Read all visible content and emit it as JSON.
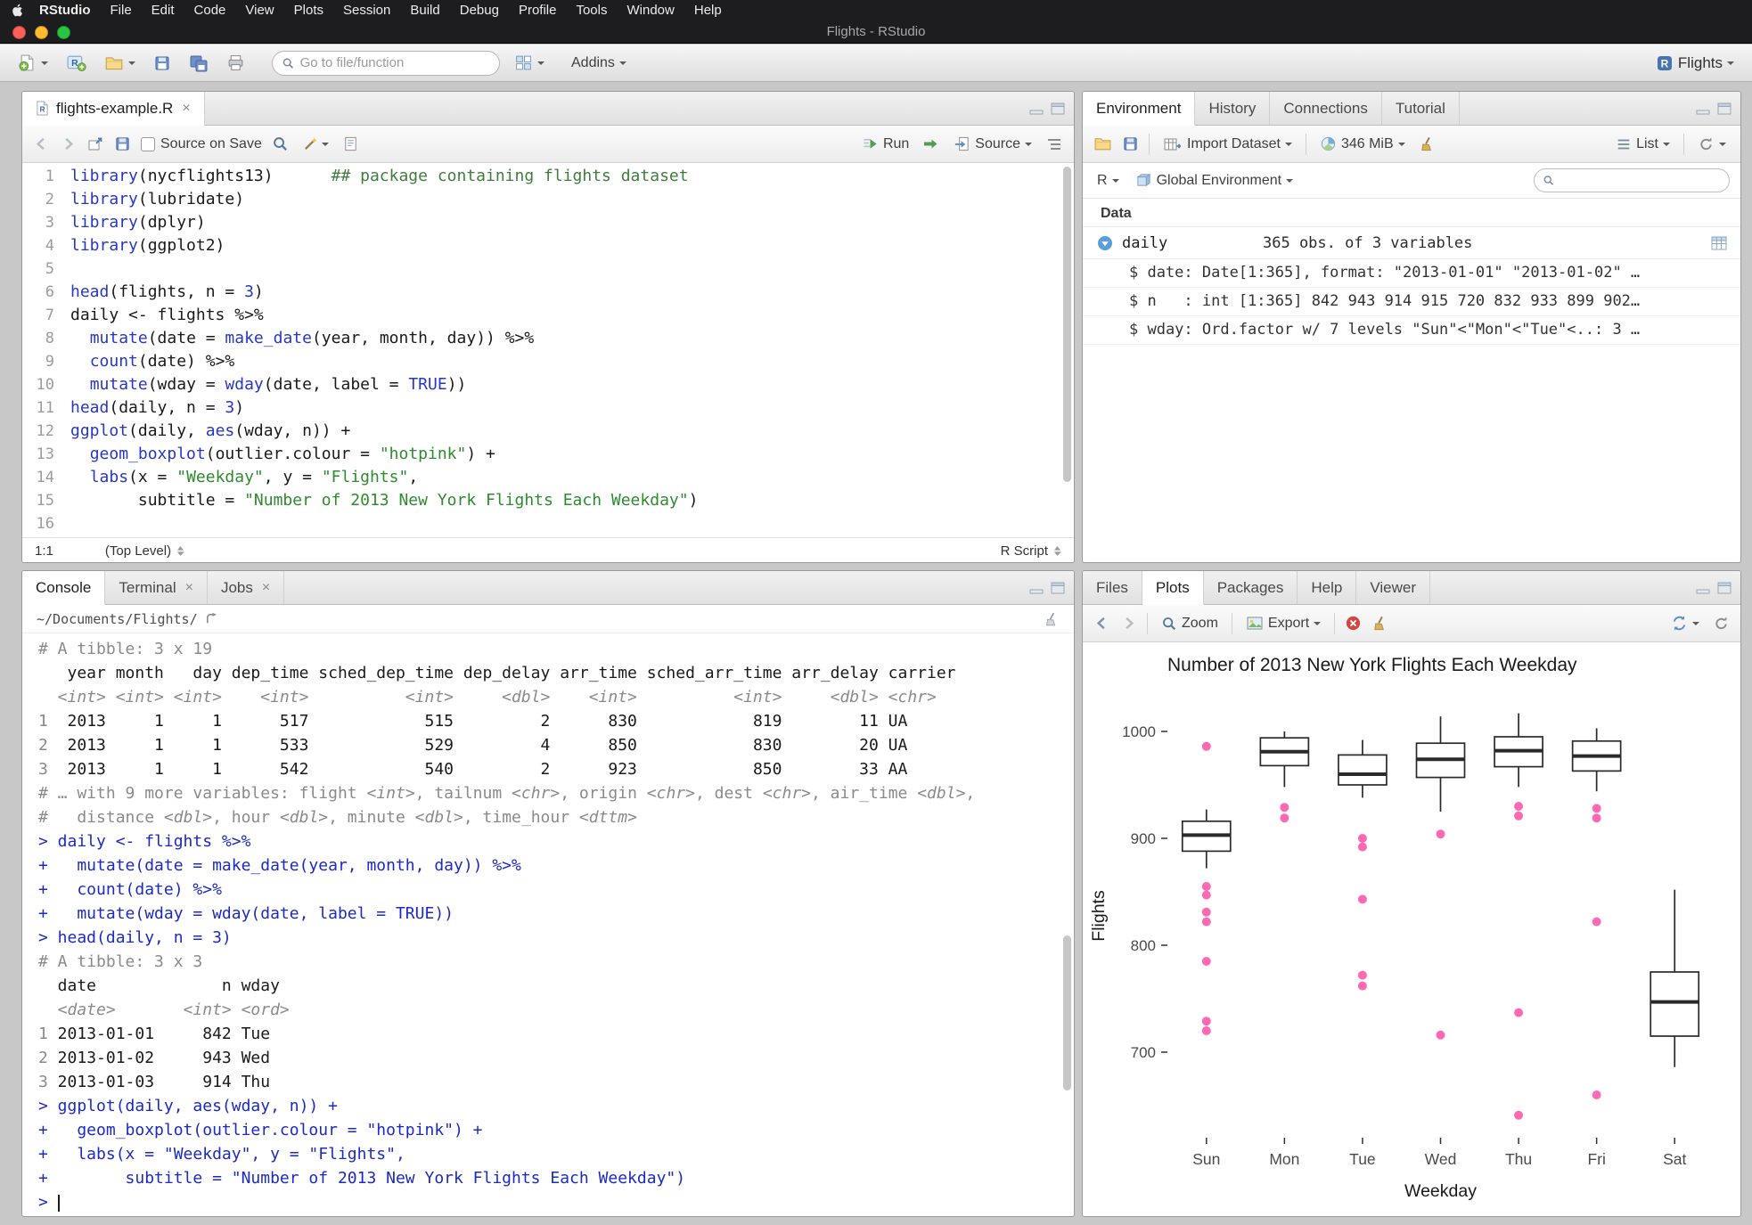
{
  "colors": {
    "hotpink": "#ff69b4",
    "accent": "#4775b4"
  },
  "icons": {
    "close": "×"
  },
  "menubar": {
    "app": "RStudio",
    "items": [
      "File",
      "Edit",
      "Code",
      "View",
      "Plots",
      "Session",
      "Build",
      "Debug",
      "Profile",
      "Tools",
      "Window",
      "Help"
    ],
    "window_title": "Flights - RStudio"
  },
  "main_toolbar": {
    "goto_placeholder": "Go to file/function",
    "addins_label": "Addins",
    "project_label": "Flights"
  },
  "source_pane": {
    "tab_title": "flights-example.R",
    "toolbar": {
      "source_on_save": "Source on Save",
      "run_label": "Run",
      "source_label": "Source"
    },
    "status": {
      "position": "1:1",
      "scope": "(Top Level)",
      "type": "R Script"
    },
    "code_lines": [
      [
        [
          "f",
          "library"
        ],
        [
          "t",
          "(nycflights13)"
        ],
        [
          "t",
          "      "
        ],
        [
          "c",
          "## package containing flights dataset"
        ]
      ],
      [
        [
          "f",
          "library"
        ],
        [
          "t",
          "(lubridate)"
        ]
      ],
      [
        [
          "f",
          "library"
        ],
        [
          "t",
          "(dplyr)"
        ]
      ],
      [
        [
          "f",
          "library"
        ],
        [
          "t",
          "(ggplot2)"
        ]
      ],
      [],
      [
        [
          "f",
          "head"
        ],
        [
          "t",
          "(flights, n = "
        ],
        [
          "n",
          "3"
        ],
        [
          "t",
          ")"
        ]
      ],
      [
        [
          "t",
          "daily <- flights %>%"
        ]
      ],
      [
        [
          "t",
          "  "
        ],
        [
          "f",
          "mutate"
        ],
        [
          "t",
          "(date = "
        ],
        [
          "f",
          "make_date"
        ],
        [
          "t",
          "(year, month, day)) %>%"
        ]
      ],
      [
        [
          "t",
          "  "
        ],
        [
          "f",
          "count"
        ],
        [
          "t",
          "(date) %>%"
        ]
      ],
      [
        [
          "t",
          "  "
        ],
        [
          "f",
          "mutate"
        ],
        [
          "t",
          "(wday = "
        ],
        [
          "f",
          "wday"
        ],
        [
          "t",
          "(date, label = "
        ],
        [
          "n",
          "TRUE"
        ],
        [
          "t",
          "))"
        ]
      ],
      [
        [
          "f",
          "head"
        ],
        [
          "t",
          "(daily, n = "
        ],
        [
          "n",
          "3"
        ],
        [
          "t",
          ")"
        ]
      ],
      [
        [
          "f",
          "ggplot"
        ],
        [
          "t",
          "(daily, "
        ],
        [
          "f",
          "aes"
        ],
        [
          "t",
          "(wday, n)) +"
        ]
      ],
      [
        [
          "t",
          "  "
        ],
        [
          "f",
          "geom_boxplot"
        ],
        [
          "t",
          "(outlier.colour = "
        ],
        [
          "s",
          "\"hotpink\""
        ],
        [
          "t",
          ") +"
        ]
      ],
      [
        [
          "t",
          "  "
        ],
        [
          "f",
          "labs"
        ],
        [
          "t",
          "(x = "
        ],
        [
          "s",
          "\"Weekday\""
        ],
        [
          "t",
          ", y = "
        ],
        [
          "s",
          "\"Flights\""
        ],
        [
          "t",
          ","
        ]
      ],
      [
        [
          "t",
          "       subtitle = "
        ],
        [
          "s",
          "\"Number of 2013 New York Flights Each Weekday\""
        ],
        [
          "t",
          ")"
        ]
      ],
      []
    ]
  },
  "console_pane": {
    "tabs": [
      {
        "label": "Console",
        "selected": true
      },
      {
        "label": "Terminal",
        "closable": true
      },
      {
        "label": "Jobs",
        "closable": true
      }
    ],
    "cwd": "~/Documents/Flights/",
    "lines": [
      [
        [
          "gr",
          "# A tibble: 3 x 19"
        ]
      ],
      [
        [
          "t",
          "   year month   day dep_time sched_dep_time dep_delay arr_time sched_arr_time arr_delay carrier"
        ]
      ],
      [
        [
          "it",
          "  <int> <int> <int>    <int>          <int>     <dbl>    <int>          <int>     <dbl> <chr>  "
        ]
      ],
      [
        [
          "gr",
          "1"
        ],
        [
          "t",
          "  2013     1     1      517            515         2      830            819        11 UA     "
        ]
      ],
      [
        [
          "gr",
          "2"
        ],
        [
          "t",
          "  2013     1     1      533            529         4      850            830        20 UA     "
        ]
      ],
      [
        [
          "gr",
          "3"
        ],
        [
          "t",
          "  2013     1     1      542            540         2      923            850        33 AA     "
        ]
      ],
      [
        [
          "gr",
          "# … with 9 more variables: flight "
        ],
        [
          "it",
          "<int>"
        ],
        [
          "gr",
          ", tailnum "
        ],
        [
          "it",
          "<chr>"
        ],
        [
          "gr",
          ", origin "
        ],
        [
          "it",
          "<chr>"
        ],
        [
          "gr",
          ", dest "
        ],
        [
          "it",
          "<chr>"
        ],
        [
          "gr",
          ", air_time "
        ],
        [
          "it",
          "<dbl>"
        ],
        [
          "gr",
          ","
        ]
      ],
      [
        [
          "gr",
          "#   distance "
        ],
        [
          "it",
          "<dbl>"
        ],
        [
          "gr",
          ", hour "
        ],
        [
          "it",
          "<dbl>"
        ],
        [
          "gr",
          ", minute "
        ],
        [
          "it",
          "<dbl>"
        ],
        [
          "gr",
          ", time_hour "
        ],
        [
          "it",
          "<dttm>"
        ]
      ],
      [
        [
          "in",
          "> daily <- flights %>%"
        ]
      ],
      [
        [
          "in",
          "+   mutate(date = make_date(year, month, day)) %>%"
        ]
      ],
      [
        [
          "in",
          "+   count(date) %>%"
        ]
      ],
      [
        [
          "in",
          "+   mutate(wday = wday(date, label = TRUE))"
        ]
      ],
      [
        [
          "in",
          "> head(daily, n = 3)"
        ]
      ],
      [
        [
          "gr",
          "# A tibble: 3 x 3"
        ]
      ],
      [
        [
          "t",
          "  date             n wday "
        ]
      ],
      [
        [
          "it",
          "  <date>       <int> <ord>"
        ]
      ],
      [
        [
          "gr",
          "1"
        ],
        [
          "t",
          " 2013-01-01     842 Tue  "
        ]
      ],
      [
        [
          "gr",
          "2"
        ],
        [
          "t",
          " 2013-01-02     943 Wed  "
        ]
      ],
      [
        [
          "gr",
          "3"
        ],
        [
          "t",
          " 2013-01-03     914 Thu  "
        ]
      ],
      [
        [
          "in",
          "> ggplot(daily, aes(wday, n)) +"
        ]
      ],
      [
        [
          "in",
          "+   geom_boxplot(outlier.colour = \"hotpink\") +"
        ]
      ],
      [
        [
          "in",
          "+   labs(x = \"Weekday\", y = \"Flights\","
        ]
      ],
      [
        [
          "in",
          "+        subtitle = \"Number of 2013 New York Flights Each Weekday\")"
        ]
      ],
      [
        [
          "in",
          "> "
        ]
      ]
    ]
  },
  "environment_pane": {
    "tabs": [
      {
        "label": "Environment",
        "selected": true
      },
      {
        "label": "History"
      },
      {
        "label": "Connections"
      },
      {
        "label": "Tutorial"
      }
    ],
    "toolbar": {
      "import_label": "Import Dataset",
      "memory_label": "346 MiB",
      "list_label": "List"
    },
    "toolbar2": {
      "lang": "R",
      "env_label": "Global Environment"
    },
    "section_label": "Data",
    "object": {
      "name": "daily",
      "desc": "365 obs. of 3 variables"
    },
    "details": [
      "$ date: Date[1:365], format: \"2013-01-01\" \"2013-01-02\" …",
      "$ n   : int [1:365] 842 943 914 915 720 832 933 899 902…",
      "$ wday: Ord.factor w/ 7 levels \"Sun\"<\"Mon\"<\"Tue\"<..: 3 …"
    ]
  },
  "plots_pane": {
    "tabs": [
      {
        "label": "Files"
      },
      {
        "label": "Plots",
        "selected": true
      },
      {
        "label": "Packages"
      },
      {
        "label": "Help"
      },
      {
        "label": "Viewer"
      }
    ],
    "toolbar": {
      "zoom_label": "Zoom",
      "export_label": "Export"
    }
  },
  "chart_data": {
    "type": "boxplot",
    "title": "Number of 2013 New York Flights Each Weekday",
    "xlabel": "Weekday",
    "ylabel": "Flights",
    "categories": [
      "Sun",
      "Mon",
      "Tue",
      "Wed",
      "Thu",
      "Fri",
      "Sat"
    ],
    "ylim": [
      620,
      1035
    ],
    "yticks": [
      700,
      800,
      900,
      1000
    ],
    "grid": false,
    "legend": false,
    "outlier_color": "#ff69b4",
    "series": [
      {
        "name": "Sun",
        "lo": 872,
        "q1": 888,
        "median": 903,
        "q3": 916,
        "hi": 927,
        "outliers": [
          986,
          855,
          847,
          831,
          822,
          785,
          729,
          720
        ]
      },
      {
        "name": "Mon",
        "lo": 948,
        "q1": 968,
        "median": 981,
        "q3": 994,
        "hi": 1000,
        "outliers": [
          929,
          919
        ]
      },
      {
        "name": "Tue",
        "lo": 938,
        "q1": 950,
        "median": 960,
        "q3": 978,
        "hi": 992,
        "outliers": [
          900,
          892,
          843,
          772,
          762
        ]
      },
      {
        "name": "Wed",
        "lo": 925,
        "q1": 957,
        "median": 974,
        "q3": 989,
        "hi": 1014,
        "outliers": [
          904,
          716
        ]
      },
      {
        "name": "Thu",
        "lo": 948,
        "q1": 967,
        "median": 982,
        "q3": 995,
        "hi": 1017,
        "outliers": [
          930,
          921,
          737,
          641
        ]
      },
      {
        "name": "Fri",
        "lo": 944,
        "q1": 963,
        "median": 977,
        "q3": 991,
        "hi": 1003,
        "outliers": [
          928,
          919,
          822,
          660
        ]
      },
      {
        "name": "Sat",
        "lo": 686,
        "q1": 715,
        "median": 747,
        "q3": 775,
        "hi": 852,
        "outliers": []
      }
    ]
  }
}
